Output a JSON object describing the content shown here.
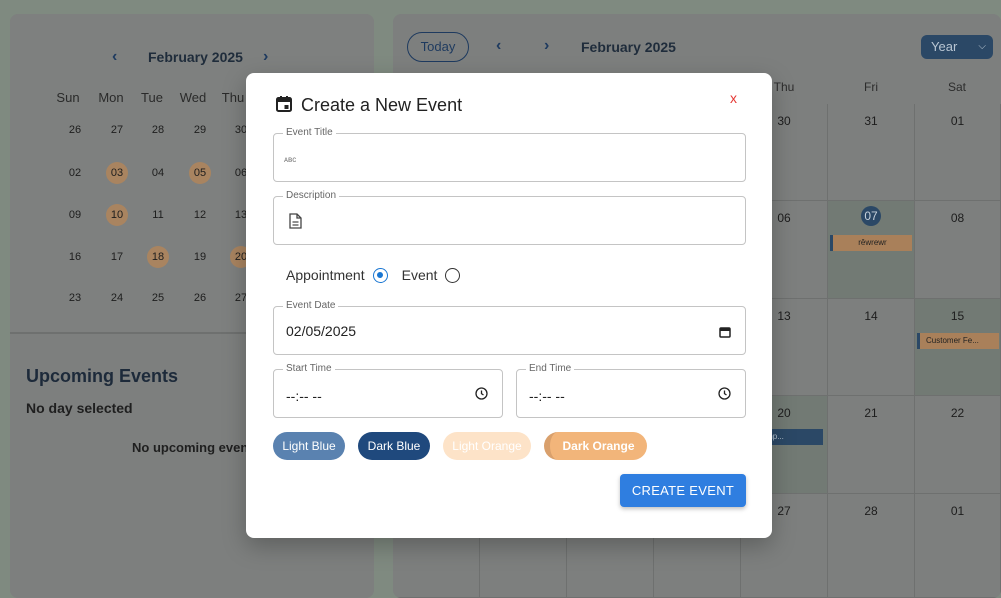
{
  "mini_calendar": {
    "prev": "‹",
    "next": "›",
    "month": "February 2025",
    "dow": [
      "Sun",
      "Mon",
      "Tue",
      "Wed",
      "Thu"
    ],
    "weeks": [
      [
        "26",
        "27",
        "28",
        "29",
        "30"
      ],
      [
        "02",
        "03",
        "04",
        "05",
        "06"
      ],
      [
        "09",
        "10",
        "11",
        "12",
        "13"
      ],
      [
        "16",
        "17",
        "18",
        "19",
        "20"
      ],
      [
        "23",
        "24",
        "25",
        "26",
        "27"
      ]
    ]
  },
  "upcoming": {
    "title": "Upcoming Events",
    "no_day": "No day selected",
    "no_events": "No upcoming events"
  },
  "main_calendar": {
    "today": "Today",
    "prev": "‹",
    "next": "›",
    "month": "February 2025",
    "view": "Year",
    "dow": [
      "Thu",
      "Fri",
      "Sat"
    ],
    "rows": [
      [
        "30",
        "31",
        "01"
      ],
      [
        "06",
        "07",
        "08"
      ],
      [
        "13",
        "14",
        "15"
      ],
      [
        "20",
        "21",
        "22"
      ],
      [
        "27",
        "28",
        "01"
      ]
    ],
    "events": {
      "fri_07": "rêwrewr",
      "sat_15": "Customer Fe...",
      "thu_20": "ual Comp..."
    }
  },
  "modal": {
    "title": "Create a New Event",
    "close": "x",
    "event_title_label": "Event Title",
    "event_title_value": "",
    "event_title_placeholder": "ᴀʙᴄ",
    "description_label": "Description",
    "radio_appointment": "Appointment",
    "radio_event": "Event",
    "event_date_label": "Event Date",
    "event_date_value": "02/05/2025",
    "start_time_label": "Start Time",
    "start_time_value": "--:-- --",
    "end_time_label": "End Time",
    "end_time_value": "--:-- --",
    "colors": {
      "light_blue": "Light Blue",
      "dark_blue": "Dark Blue",
      "light_orange": "Light Orange",
      "dark_orange": "Dark Orange"
    },
    "create": "CREATE EVENT"
  }
}
